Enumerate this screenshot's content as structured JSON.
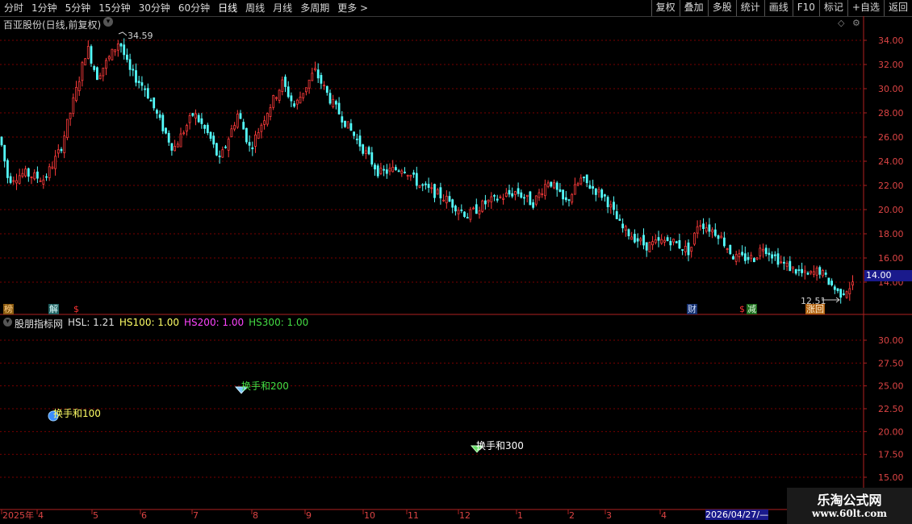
{
  "toolbar": {
    "periods": [
      "分时",
      "1分钟",
      "5分钟",
      "15分钟",
      "30分钟",
      "60分钟",
      "日线",
      "周线",
      "月线",
      "多周期",
      "更多"
    ],
    "active_period": "日线",
    "buttons": [
      "复权",
      "叠加",
      "多股",
      "统计",
      "画线",
      "F10",
      "标记",
      "+自选",
      "返回"
    ]
  },
  "main_chart": {
    "title": "百亚股份(日线,前复权)",
    "price_axis": [
      "34.00",
      "32.00",
      "30.00",
      "28.00",
      "26.00",
      "24.00",
      "22.00",
      "20.00",
      "18.00",
      "16.00",
      "14.00"
    ],
    "current_price": "14.00",
    "high_label": "34.59",
    "low_label": "12.51",
    "signals": [
      "榜",
      "解",
      "$",
      "财",
      "$",
      "减",
      "涨回"
    ]
  },
  "indicator": {
    "name": "股朋指标网",
    "values": [
      {
        "key": "HSL",
        "text": "HSL: 1.21",
        "color": "#e0e0e0"
      },
      {
        "key": "HS100",
        "text": "HS100: 1.00",
        "color": "#ffff66"
      },
      {
        "key": "HS200",
        "text": "HS200: 1.00",
        "color": "#ff44ff"
      },
      {
        "key": "HS300",
        "text": "HS300: 1.00",
        "color": "#44dd44"
      }
    ],
    "axis": [
      "30.00",
      "27.50",
      "25.00",
      "22.50",
      "20.00",
      "17.50",
      "15.00"
    ],
    "markers": [
      {
        "label": "换手和100",
        "color": "#ffff66"
      },
      {
        "label": "换手和200",
        "color": "#44dd44"
      },
      {
        "label": "换手和300",
        "color": "#ffffff"
      }
    ]
  },
  "time_axis": {
    "labels": [
      "2025年",
      "4",
      "5",
      "6",
      "7",
      "8",
      "9",
      "10",
      "11",
      "12",
      "1",
      "2",
      "3",
      "4"
    ],
    "current_date": "2026/04/27/—"
  },
  "watermark": {
    "line1": "乐淘公式网",
    "line2": "www.60lt.com"
  },
  "colors": {
    "up": "#ff3b3b",
    "down": "#54fcfc",
    "grid": "#7a0000",
    "axis": "#b02020"
  }
}
